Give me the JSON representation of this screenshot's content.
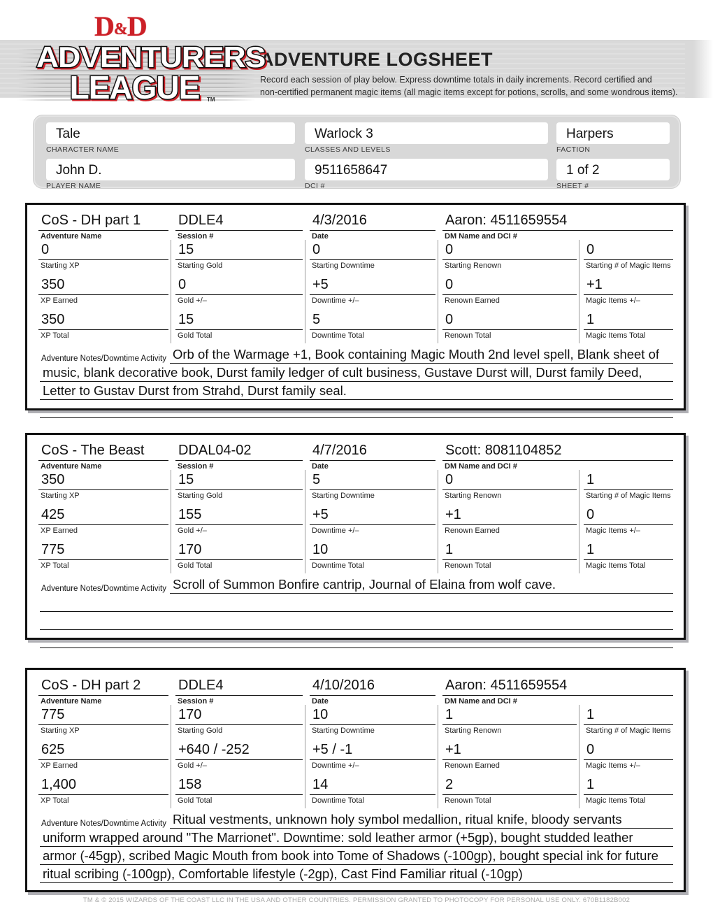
{
  "brand": {
    "dnd": "D&D",
    "line1": "ADVENTURERS",
    "line2": "LEAGUE",
    "tm": "TM"
  },
  "header": {
    "title": "Adventure Logsheet",
    "subtitle_line1": "Record each session of play below. Express downtime totals in daily increments. Record certified and",
    "subtitle_line2": "non-certified permanent magic items (all magic items except for potions, scrolls, and some wondrous items)."
  },
  "character": {
    "character_name": {
      "label": "CHARACTER NAME",
      "value": "Tale"
    },
    "classes_and_levels": {
      "label": "CLASSES AND LEVELS",
      "value": "Warlock 3"
    },
    "faction": {
      "label": "FACTION",
      "value": "Harpers"
    },
    "player_name": {
      "label": "PLAYER NAME",
      "value": "John D."
    },
    "dci": {
      "label": "DCI #",
      "value": "9511658647"
    },
    "sheet": {
      "label": "SHEET #",
      "value": "1 of 2"
    }
  },
  "labels": {
    "adventure_name": "Adventure Name",
    "session": "Session #",
    "date": "Date",
    "dm": "DM Name and DCI #",
    "starting_xp": "Starting XP",
    "starting_gold": "Starting Gold",
    "starting_downtime": "Starting Downtime",
    "starting_renown": "Starting Renown",
    "starting_magic_items": "Starting # of Magic Items",
    "xp_earned": "XP Earned",
    "gold_delta": "Gold +/–",
    "downtime_delta": "Downtime +/–",
    "renown_earned": "Renown Earned",
    "magic_items_delta": "Magic Items +/–",
    "xp_total": "XP Total",
    "gold_total": "Gold Total",
    "downtime_total": "Downtime Total",
    "renown_total": "Renown Total",
    "magic_items_total": "Magic Items Total",
    "notes": "Adventure Notes/Downtime Activity"
  },
  "entries": [
    {
      "adventure_name": "CoS - DH part 1",
      "session": "DDLE4",
      "date": "4/3/2016",
      "dm": "Aaron:  4511659554",
      "starting_xp": "0",
      "starting_gold": "15",
      "starting_downtime": "0",
      "starting_renown": "0",
      "starting_magic_items": "0",
      "xp_earned": "350",
      "gold_delta": "0",
      "downtime_delta": "+5",
      "renown_earned": "0",
      "magic_items_delta": "+1",
      "xp_total": "350",
      "gold_total": "15",
      "downtime_total": "5",
      "renown_total": "0",
      "magic_items_total": "1",
      "notes_line1": "Orb of the Warmage +1, Book containing Magic Mouth 2nd level spell, Blank sheet of",
      "notes_line2": "music, blank decorative book, Durst family ledger of cult business, Gustave Durst will, Durst family Deed,",
      "notes_line3": "Letter to Gustav Durst from Strahd, Durst family seal.",
      "notes_line4": ""
    },
    {
      "adventure_name": "CoS - The Beast",
      "session": "DDAL04-02",
      "date": "4/7/2016",
      "dm": "Scott:  8081104852",
      "starting_xp": "350",
      "starting_gold": "15",
      "starting_downtime": "5",
      "starting_renown": "0",
      "starting_magic_items": "1",
      "xp_earned": "425",
      "gold_delta": "155",
      "downtime_delta": "+5",
      "renown_earned": "+1",
      "magic_items_delta": "0",
      "xp_total": "775",
      "gold_total": "170",
      "downtime_total": "10",
      "renown_total": "1",
      "magic_items_total": "1",
      "notes_line1": "Scroll of Summon Bonfire cantrip, Journal of Elaina from wolf cave.",
      "notes_line2": "",
      "notes_line3": "",
      "notes_line4": ""
    },
    {
      "adventure_name": "CoS - DH part 2",
      "session": "DDLE4",
      "date": "4/10/2016",
      "dm": "Aaron:  4511659554",
      "starting_xp": "775",
      "starting_gold": "170",
      "starting_downtime": "10",
      "starting_renown": "1",
      "starting_magic_items": "1",
      "xp_earned": "625",
      "gold_delta": "+640 / -252",
      "downtime_delta": "+5 / -1",
      "renown_earned": "+1",
      "magic_items_delta": "0",
      "xp_total": "1,400",
      "gold_total": "158",
      "downtime_total": "14",
      "renown_total": "2",
      "magic_items_total": "1",
      "notes_line1": "Ritual vestments, unknown holy symbol medallion, ritual knife, bloody servants",
      "notes_line2": "uniform wrapped around \"The Marrionet\".  Downtime:  sold leather armor (+5gp), bought studded leather",
      "notes_line3": "armor (-45gp), scribed Magic Mouth from book into Tome of Shadows (-100gp), bought special ink for future",
      "notes_line4": "ritual scribing (-100gp), Comfortable lifestyle (-2gp), Cast Find Familiar ritual (-10gp)"
    }
  ],
  "footer": "TM & © 2015 Wizards of the Coast LLC in the USA and other countries. Permission granted to photocopy for personal use only. 670B1182B002"
}
